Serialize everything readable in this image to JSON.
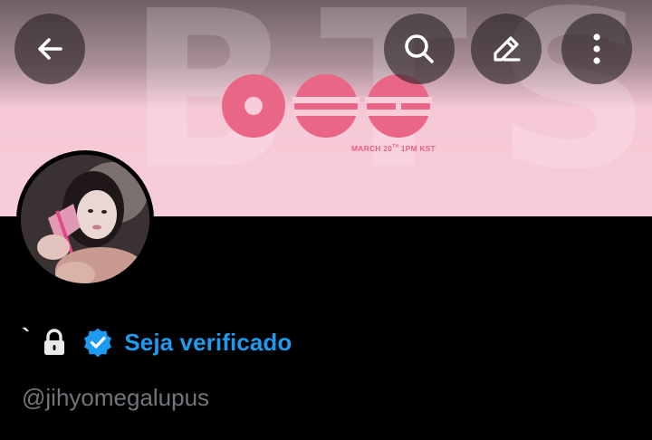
{
  "banner": {
    "watermark": "BTS",
    "date_text": "MARCH 20",
    "date_sup": "TH",
    "time_text": " 1PM KST",
    "accent_color": "#e8627f"
  },
  "toolbar": {
    "back_icon": "arrow-left-icon",
    "search_icon": "search-icon",
    "edit_icon": "pencil-icon",
    "more_icon": "more-vertical-icon"
  },
  "profile": {
    "name": "`",
    "lock_icon": "lock-icon",
    "verified_icon": "verified-badge-icon",
    "verify_label": "Seja verificado",
    "handle": "@jihyomegalupus"
  },
  "colors": {
    "link": "#1d9bf0",
    "secondary_text": "#71767b",
    "background": "#000000"
  }
}
